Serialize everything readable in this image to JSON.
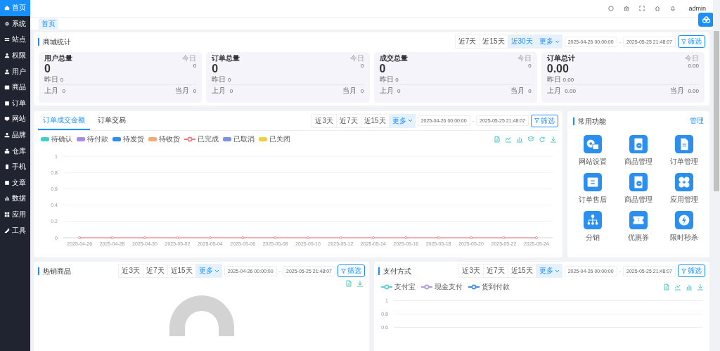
{
  "sidebar": {
    "items": [
      {
        "label": "首页",
        "selected": true
      },
      {
        "label": "系统",
        "selected": false
      },
      {
        "label": "站点",
        "selected": false
      },
      {
        "label": "权限",
        "selected": false
      },
      {
        "label": "用户",
        "selected": false
      },
      {
        "label": "商品",
        "selected": false
      },
      {
        "label": "订单",
        "selected": false
      },
      {
        "label": "网站",
        "selected": false
      },
      {
        "label": "品牌",
        "selected": false
      },
      {
        "label": "仓库",
        "selected": false
      },
      {
        "label": "手机",
        "selected": false
      },
      {
        "label": "文章",
        "selected": false
      },
      {
        "label": "数据",
        "selected": false
      },
      {
        "label": "应用",
        "selected": false
      },
      {
        "label": "工具",
        "selected": false
      }
    ]
  },
  "header": {
    "user": "admin"
  },
  "tabs": [
    {
      "label": "首页",
      "selected": true
    }
  ],
  "store_stats": {
    "title": "商城统计",
    "filter": {
      "ranges": [
        {
          "label": "近7天",
          "selected": false
        },
        {
          "label": "近15天",
          "selected": false
        },
        {
          "label": "近30天",
          "selected": true
        }
      ],
      "more": "更多",
      "start": "2025-04-26 00:00:00",
      "separator": "-",
      "end": "2025-05-25 21:48:07",
      "button": "筛选"
    },
    "cards": [
      {
        "title": "用户总量",
        "today_label": "今日",
        "today": "0",
        "value": "0",
        "yesterday_label": "昨日",
        "yesterday": "0",
        "last_month_label": "上月",
        "last_month": "0",
        "this_month_label": "当月",
        "this_month": "0"
      },
      {
        "title": "订单总量",
        "today_label": "今日",
        "today": "0",
        "value": "0",
        "yesterday_label": "昨日",
        "yesterday": "0",
        "last_month_label": "上月",
        "last_month": "0",
        "this_month_label": "当月",
        "this_month": "0"
      },
      {
        "title": "成交总量",
        "today_label": "今日",
        "today": "0",
        "value": "0",
        "yesterday_label": "昨日",
        "yesterday": "0",
        "last_month_label": "上月",
        "last_month": "0",
        "this_month_label": "当月",
        "this_month": "0"
      },
      {
        "title": "订单总计",
        "today_label": "今日",
        "today": "0.00",
        "value": "0.00",
        "yesterday_label": "昨日",
        "yesterday": "0.00",
        "last_month_label": "上月",
        "last_month": "0.00",
        "this_month_label": "当月",
        "this_month": "0.00"
      }
    ]
  },
  "order_chart": {
    "tabs": [
      {
        "label": "订单成交金额",
        "selected": true
      },
      {
        "label": "订单交易",
        "selected": false
      }
    ],
    "filter": {
      "ranges": [
        {
          "label": "近3天",
          "selected": false
        },
        {
          "label": "近7天",
          "selected": false
        },
        {
          "label": "近15天",
          "selected": false
        }
      ],
      "more": "更多",
      "start": "2025-04-26 00:00:00",
      "separator": "-",
      "end": "2025-05-25 21:48:07",
      "button": "筛选"
    },
    "legend": [
      {
        "name": "待确认",
        "kind": "swatch",
        "color": "#3fd0c9"
      },
      {
        "name": "待付款",
        "kind": "swatch",
        "color": "#a78be6"
      },
      {
        "name": "待发货",
        "kind": "swatch",
        "color": "#2b8ff0"
      },
      {
        "name": "待收货",
        "kind": "swatch",
        "color": "#f8a877"
      },
      {
        "kind": "series"
      },
      {
        "name": "已取消",
        "kind": "swatch",
        "color": "#7b93de"
      },
      {
        "name": "已关闭",
        "kind": "swatch",
        "color": "#efd23c"
      }
    ],
    "chart_data": {
      "type": "line",
      "grid": true,
      "categories": [
        "2025-04-26",
        "2025-04-28",
        "2025-04-30",
        "2025-05-02",
        "2025-05-04",
        "2025-05-06",
        "2025-05-08",
        "2025-05-10",
        "2025-05-12",
        "2025-05-14",
        "2025-05-16",
        "2025-05-18",
        "2025-05-20",
        "2025-05-22",
        "2025-05-24"
      ],
      "ylim": [
        0,
        1
      ],
      "yticks": [
        0,
        0.2,
        0.4,
        0.6,
        0.8,
        1
      ],
      "series": [
        {
          "name": "已完成",
          "color": "#ef7a7a",
          "marker": true,
          "values": [
            0,
            0,
            0,
            0,
            0,
            0,
            0,
            0,
            0,
            0,
            0,
            0,
            0,
            0,
            0
          ]
        }
      ]
    }
  },
  "quick": {
    "title": "常用功能",
    "manage": "管理",
    "items": [
      "网站设置",
      "商品管理",
      "订单管理",
      "订单售后",
      "商品管理",
      "应用管理",
      "分销",
      "优惠券",
      "限时秒杀"
    ]
  },
  "hot": {
    "title": "热销商品",
    "filter": {
      "ranges": [
        {
          "label": "近3天",
          "selected": false
        },
        {
          "label": "近7天",
          "selected": false
        },
        {
          "label": "近15天",
          "selected": false
        }
      ],
      "more": "更多",
      "start": "2025-04-26 00:00:00",
      "separator": "-",
      "end": "2025-05-25 21:48:07",
      "button": "筛选"
    }
  },
  "pay": {
    "title": "支付方式",
    "filter": {
      "ranges": [
        {
          "label": "近3天",
          "selected": false
        },
        {
          "label": "近7天",
          "selected": false
        },
        {
          "label": "近15天",
          "selected": false
        }
      ],
      "more": "更多",
      "start": "2025-04-26 00:00:00",
      "separator": "-",
      "end": "2025-05-25 21:48:07",
      "button": "筛选"
    },
    "legend": [
      {
        "name": "支付宝",
        "color": "#5ccfd0"
      },
      {
        "name": "现金支付",
        "color": "#b09ad9"
      },
      {
        "name": "货到付款",
        "color": "#3a8ee6"
      }
    ],
    "y_labels": [
      "1",
      "0.8",
      "0.6"
    ]
  }
}
